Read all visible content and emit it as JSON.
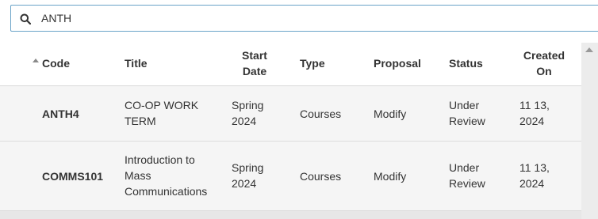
{
  "search": {
    "value": "ANTH",
    "placeholder": ""
  },
  "table": {
    "columns": {
      "code": "Code",
      "title": "Title",
      "start_date_1": "Start",
      "start_date_2": "Date",
      "type": "Type",
      "proposal": "Proposal",
      "status": "Status",
      "created_1": "Created",
      "created_2": "On"
    },
    "rows": [
      {
        "code": "ANTH4",
        "title_1": "CO-OP WORK",
        "title_2": "TERM",
        "title_3": "",
        "start_1": "Spring",
        "start_2": "2024",
        "type": "Courses",
        "proposal": "Modify",
        "status_1": "Under",
        "status_2": "Review",
        "created_1": "11 13,",
        "created_2": "2024"
      },
      {
        "code": "COMMS101",
        "title_1": "Introduction to",
        "title_2": "Mass",
        "title_3": "Communications",
        "start_1": "Spring",
        "start_2": "2024",
        "type": "Courses",
        "proposal": "Modify",
        "status_1": "Under",
        "status_2": "Review",
        "created_1": "11 13,",
        "created_2": "2024"
      }
    ]
  }
}
